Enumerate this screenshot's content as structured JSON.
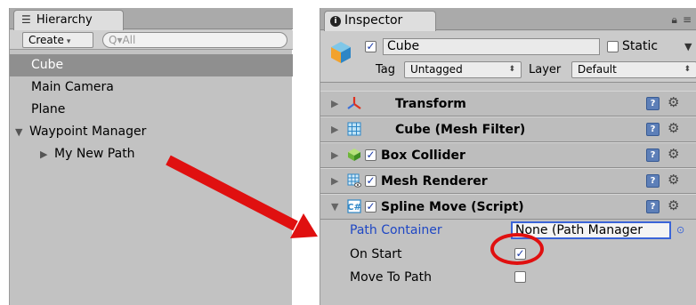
{
  "hierarchy": {
    "tab_title": "Hierarchy",
    "tab_icon": "list-icon",
    "create_label": "Create",
    "search_placeholder": "Q▾All",
    "items": [
      {
        "label": "Cube",
        "selected": true
      },
      {
        "label": "Main Camera"
      },
      {
        "label": "Plane"
      },
      {
        "label": "Waypoint Manager",
        "expanded": true
      },
      {
        "label": "My New Path",
        "collapsed": true
      }
    ]
  },
  "inspector": {
    "tab_title": "Inspector",
    "object_name": "Cube",
    "static_label": "Static",
    "tag_label": "Tag",
    "tag_value": "Untagged",
    "layer_label": "Layer",
    "layer_value": "Default",
    "components": [
      {
        "name": "Transform",
        "icon": "transform-axes-icon"
      },
      {
        "name": "Cube (Mesh Filter)",
        "icon": "mesh-grid-icon"
      },
      {
        "name": "Box Collider",
        "icon": "green-cube-icon",
        "enabled": true
      },
      {
        "name": "Mesh Renderer",
        "icon": "mesh-renderer-icon",
        "enabled": true
      },
      {
        "name": "Spline Move (Script)",
        "icon": "script-icon",
        "enabled": true,
        "expanded": true
      }
    ],
    "properties": [
      {
        "label": "Path Container",
        "value": "None (Path Manager"
      },
      {
        "label": "On Start",
        "checked": true
      },
      {
        "label": "Move To Path",
        "checked": false
      }
    ]
  },
  "colors": {
    "annotation_red": "#e01010",
    "field_blue": "#3a64d8",
    "selection_gray": "#8f8f8f"
  }
}
